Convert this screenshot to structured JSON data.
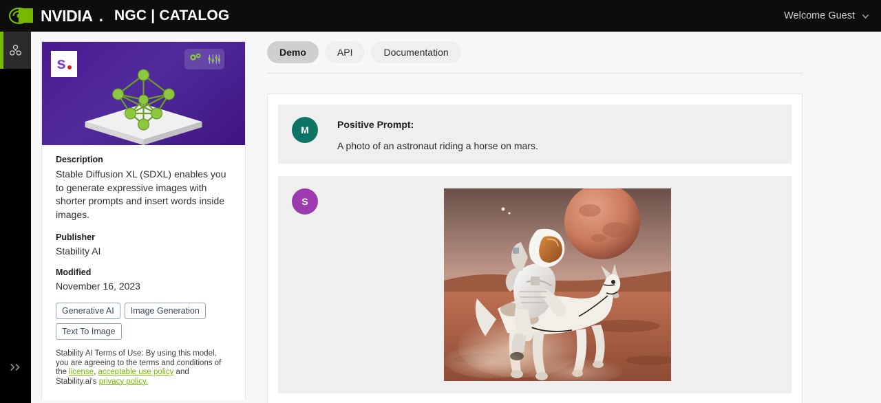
{
  "header": {
    "brand_word": "NVIDIA",
    "brand_dot": ".",
    "product": "NGC | CATALOG",
    "welcome": "Welcome Guest",
    "eye_icon": "nvidia-eye-logo",
    "chevron_icon": "chevron-down-icon"
  },
  "rail": {
    "active_item_icon": "models-cluster-icon",
    "expand_icon": "double-chevron-right-icon"
  },
  "sidebar": {
    "hero": {
      "logo_letter": "s",
      "logo_dot": ".",
      "badge_icon": "gears-sliders-icon",
      "art_icon": "molecule-on-platform-icon"
    },
    "description_label": "Description",
    "description": "Stable Diffusion XL (SDXL) enables you to generate expressive images with shorter prompts and insert words inside images.",
    "publisher_label": "Publisher",
    "publisher": "Stability AI",
    "modified_label": "Modified",
    "modified": "November 16, 2023",
    "tags": [
      "Generative AI",
      "Image Generation",
      "Text To Image"
    ],
    "terms": {
      "lead": "Stability AI Terms of Use: By using this model, you are agreeing to the terms and conditions of the ",
      "link_license": "license",
      "sep1": ", ",
      "link_aup": "acceptable use policy",
      "sep2": " and Stability.ai's ",
      "link_privacy": "privacy policy."
    }
  },
  "main": {
    "tabs": [
      {
        "label": "Demo",
        "active": true
      },
      {
        "label": "API",
        "active": false
      },
      {
        "label": "Documentation",
        "active": false
      }
    ],
    "messages": [
      {
        "avatar_letter": "M",
        "avatar_color": "#0e7566",
        "title": "Positive Prompt:",
        "text": "A photo of an astronaut riding a horse on mars."
      },
      {
        "avatar_letter": "S",
        "avatar_color": "#9c3bb0",
        "image_alt": "astronaut-riding-horse-on-mars"
      }
    ]
  },
  "colors": {
    "nvidia_green": "#76b900",
    "header_bg": "#0d0d0d",
    "page_bg": "#f7f7f7",
    "hero_purple": "#4a1a8f"
  }
}
